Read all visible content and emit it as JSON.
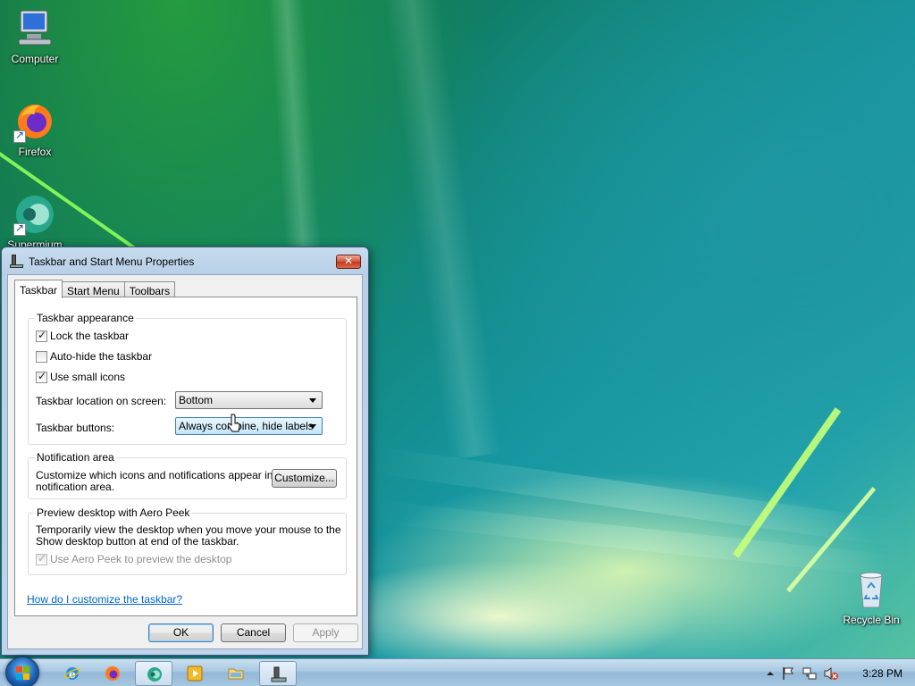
{
  "desktop": {
    "icons": [
      {
        "label": "Computer",
        "icon": "computer-icon"
      },
      {
        "label": "Firefox",
        "icon": "firefox-icon"
      },
      {
        "label": "Supermium",
        "icon": "supermium-icon"
      },
      {
        "label": "Recycle Bin",
        "icon": "recycle-bin-icon"
      }
    ]
  },
  "dialog": {
    "title": "Taskbar and Start Menu Properties",
    "close_label": "✕",
    "tabs": [
      {
        "label": "Taskbar",
        "active": true
      },
      {
        "label": "Start Menu",
        "active": false
      },
      {
        "label": "Toolbars",
        "active": false
      }
    ],
    "appearance": {
      "title": "Taskbar appearance",
      "lock": {
        "label": "Lock the taskbar",
        "checked": true
      },
      "autohide": {
        "label": "Auto-hide the taskbar",
        "checked": false
      },
      "small_icons": {
        "label": "Use small icons",
        "checked": true
      },
      "location_label": "Taskbar location on screen:",
      "location_value": "Bottom",
      "buttons_label": "Taskbar buttons:",
      "buttons_value": "Always combine, hide labels"
    },
    "notification": {
      "title": "Notification area",
      "text_line1": "Customize which icons and notifications appear in the",
      "text_line2": "notification area.",
      "customize_button": "Customize..."
    },
    "aero_peek": {
      "title": "Preview desktop with Aero Peek",
      "text_line1": "Temporarily view the desktop when you move your mouse to the",
      "text_line2": "Show desktop button at end of the taskbar.",
      "checkbox": {
        "label": "Use Aero Peek to preview the desktop",
        "checked": true,
        "disabled": true
      }
    },
    "help_link": "How do I customize the taskbar?",
    "buttons": {
      "ok": "OK",
      "cancel": "Cancel",
      "apply": "Apply"
    }
  },
  "taskbar": {
    "pinned": [
      {
        "icon": "internet-explorer-icon",
        "active": false
      },
      {
        "icon": "firefox-icon",
        "active": false
      },
      {
        "icon": "supermium-icon",
        "active": true
      },
      {
        "icon": "media-player-icon",
        "active": false
      },
      {
        "icon": "file-explorer-icon",
        "active": false
      },
      {
        "icon": "taskbar-properties-icon",
        "active": true
      }
    ],
    "tray_icons": [
      "show-hidden-icons-chevron",
      "action-center-flag-icon",
      "network-icon",
      "volume-muted-icon"
    ],
    "clock": "3:28 PM"
  },
  "colors": {
    "link": "#0066cc",
    "close_button": "#c03a20",
    "combo_hot": "#c4e5f6"
  }
}
